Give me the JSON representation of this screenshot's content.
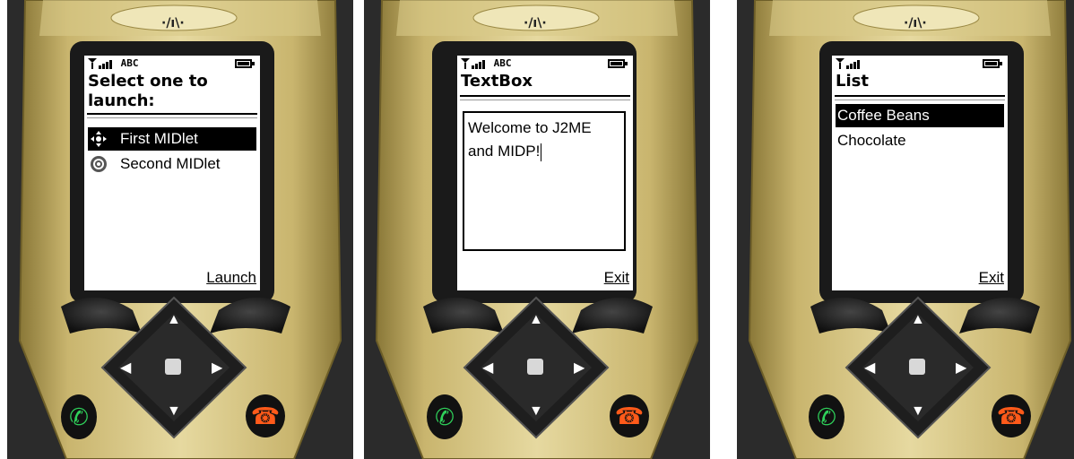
{
  "phones": [
    {
      "status": "ABC",
      "title": "Select one to launch:",
      "items": [
        {
          "label": "First MIDlet",
          "icon": "midlet-move-icon",
          "selected": true
        },
        {
          "label": "Second MIDlet",
          "icon": "midlet-target-icon",
          "selected": false
        }
      ],
      "softkey": "Launch"
    },
    {
      "status": "ABC",
      "title": "TextBox",
      "textbox_value": "Welcome to J2ME and MIDP!",
      "softkey": "Exit"
    },
    {
      "status": "",
      "title": "List",
      "items": [
        {
          "label": "Coffee Beans",
          "selected": true
        },
        {
          "label": "Chocolate",
          "selected": false
        }
      ],
      "softkey": "Exit"
    }
  ],
  "colors": {
    "body_gold": "#c9b56e",
    "body_highlight": "#e6d9a0",
    "body_shadow": "#8a7838",
    "dpad": "#1e1e1e",
    "call_green": "#2fd05a",
    "end_orange": "#ff5a1a",
    "background": "#2b2b2b"
  }
}
